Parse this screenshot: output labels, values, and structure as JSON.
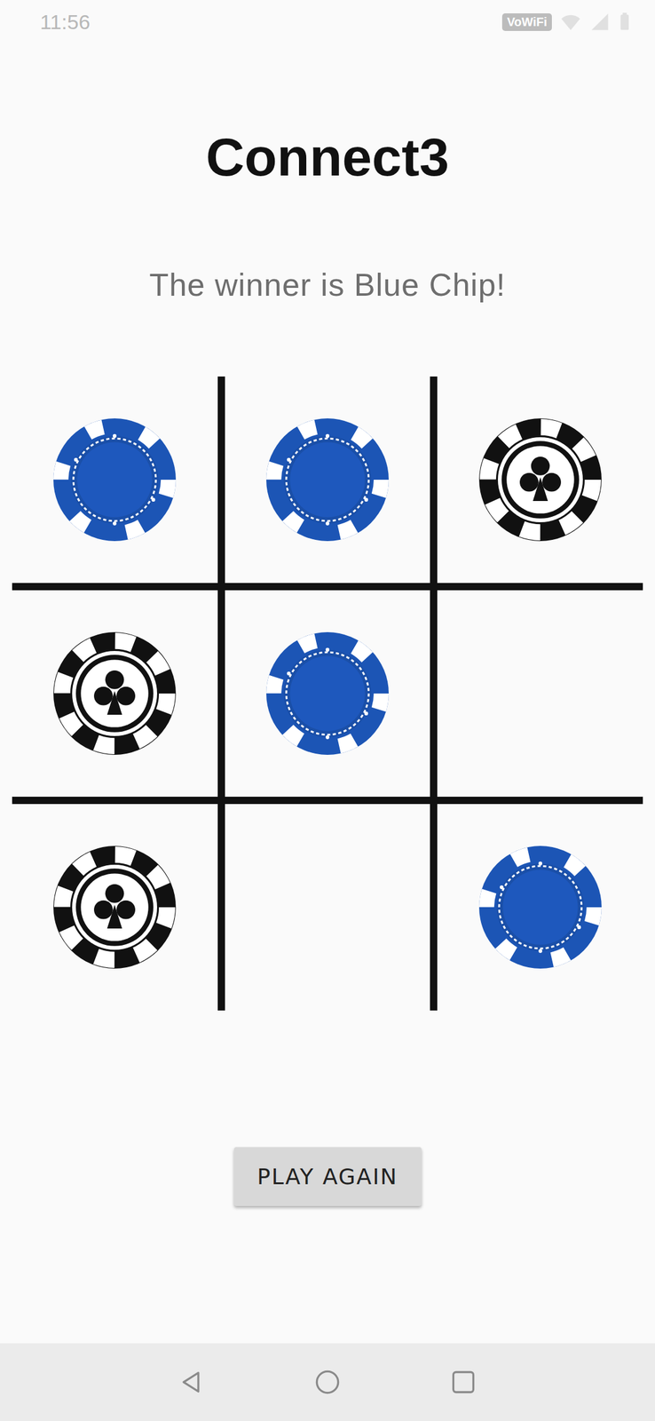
{
  "status_bar": {
    "time": "11:56",
    "badge": "VoWiFi"
  },
  "app_title": "Connect3",
  "message": "The winner is Blue Chip!",
  "board": [
    {
      "kind": "blue"
    },
    {
      "kind": "blue"
    },
    {
      "kind": "black"
    },
    {
      "kind": "black"
    },
    {
      "kind": "blue"
    },
    {
      "kind": "empty"
    },
    {
      "kind": "black"
    },
    {
      "kind": "empty"
    },
    {
      "kind": "blue"
    }
  ],
  "button": "PLAY AGAIN"
}
